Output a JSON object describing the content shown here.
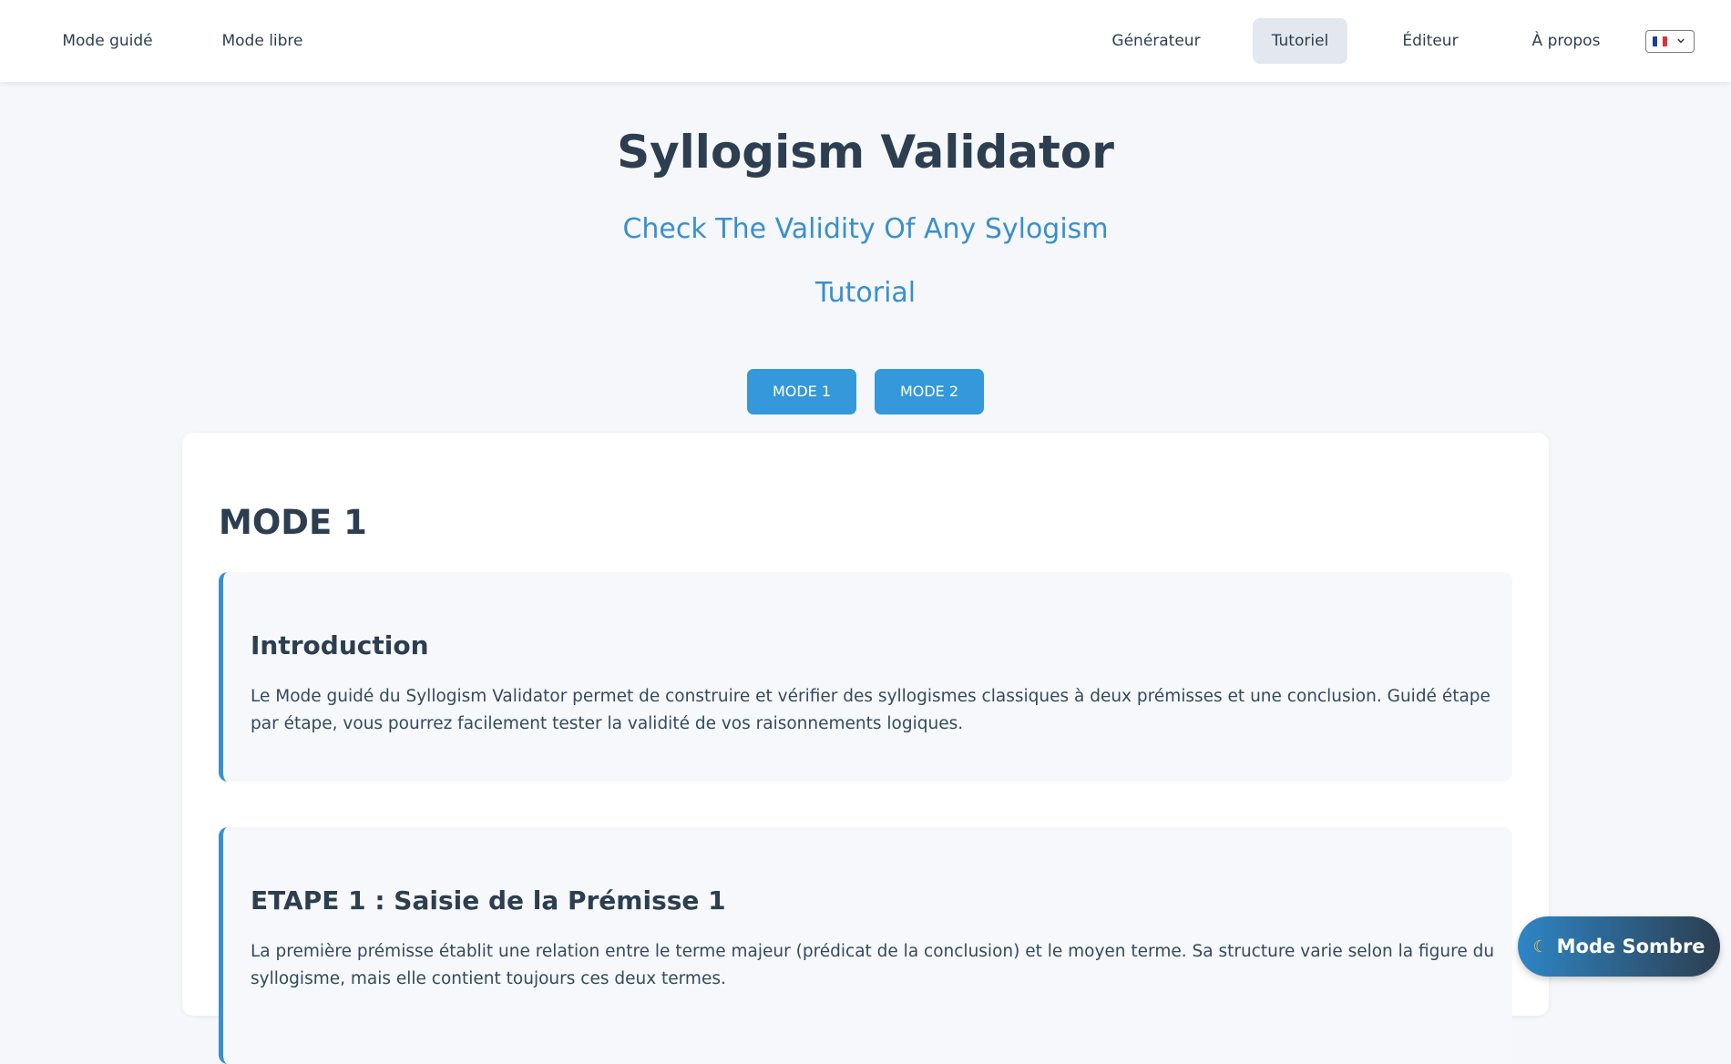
{
  "nav": {
    "left": [
      "Mode guidé",
      "Mode libre"
    ],
    "right": [
      "Générateur",
      "Tutoriel",
      "Éditeur",
      "À propos"
    ],
    "active": "Tutoriel",
    "language_flag": "fr-flag-icon"
  },
  "header": {
    "title": "Syllogism Validator",
    "subtitle": "Check The Validity Of Any Sylogism",
    "section": "Tutorial"
  },
  "mode_buttons": [
    "MODE 1",
    "MODE 2"
  ],
  "content": {
    "heading": "MODE 1",
    "sections": [
      {
        "title": "Introduction",
        "text": "Le Mode guidé du Syllogism Validator permet de construire et vérifier des syllogismes classiques à deux prémisses et une conclusion. Guidé étape par étape, vous pourrez facilement tester la validité de vos raisonnements logiques."
      },
      {
        "title": "ETAPE 1 : Saisie de la Prémisse 1",
        "text": "La première prémisse établit une relation entre le terme majeur (prédicat de la conclusion) et le moyen terme. Sa structure varie selon la figure du syllogisme, mais elle contient toujours ces deux termes."
      }
    ]
  },
  "dark_mode": {
    "icon": "moon-icon",
    "label": "Mode Sombre"
  },
  "colors": {
    "accent": "#3498db",
    "text_dark": "#2c3e50",
    "subtitle": "#3a8fce",
    "background": "#f5f7fa"
  }
}
